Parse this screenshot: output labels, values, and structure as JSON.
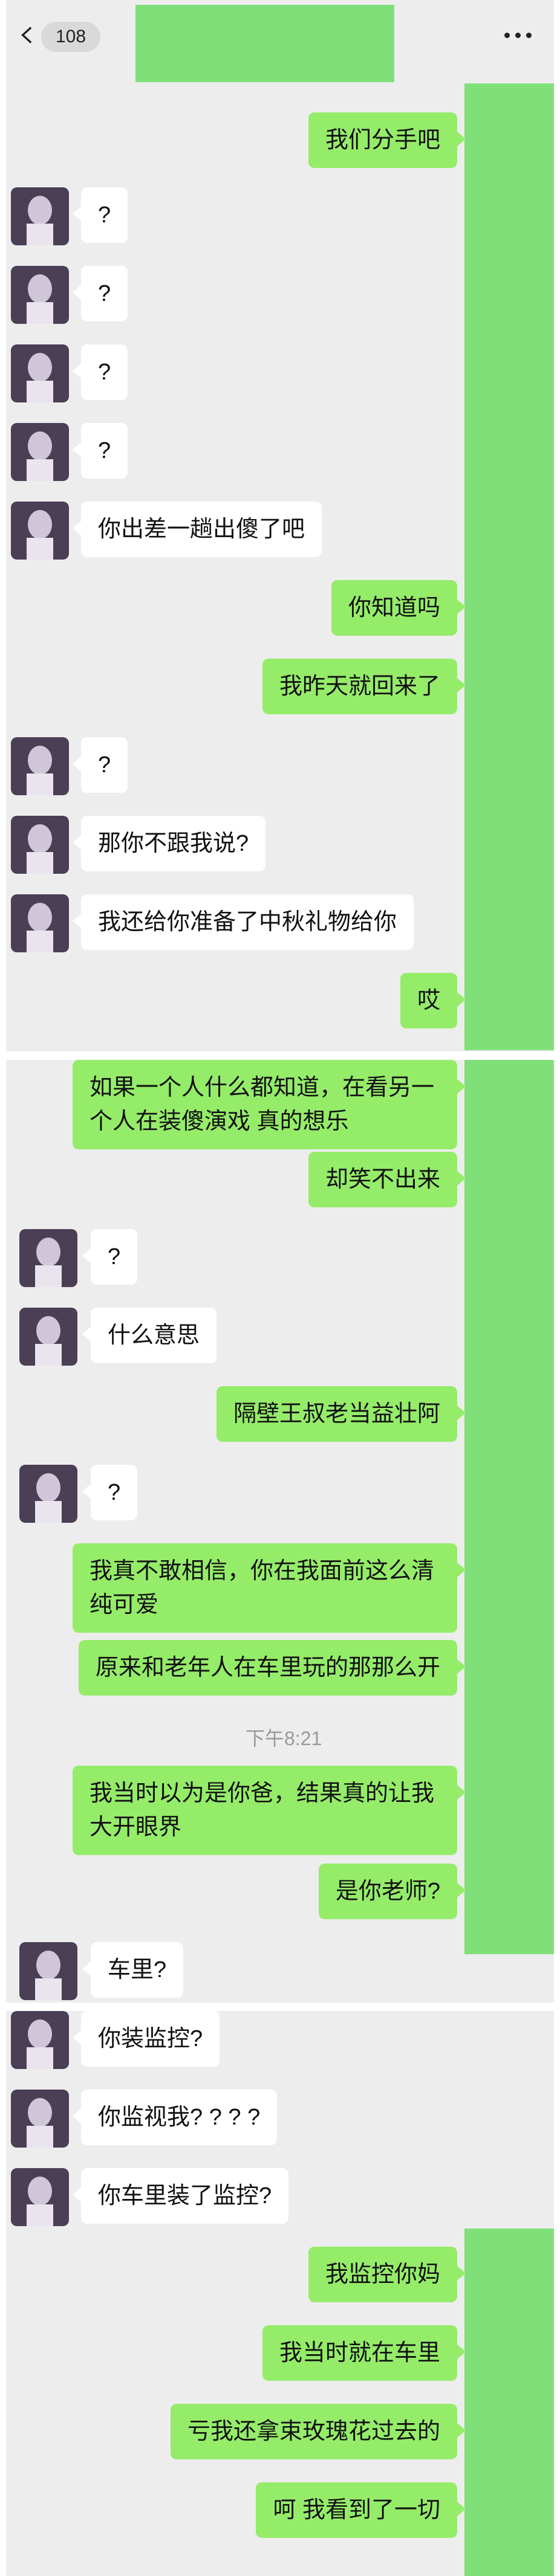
{
  "header": {
    "unread_count": "108"
  },
  "colors": {
    "panel_bg": "#ededed",
    "bubble_out": "#95ec69",
    "bubble_in": "#ffffff",
    "redaction": "#7fe07a"
  },
  "panel1": {
    "messages": [
      {
        "side": "out",
        "text": "我们分手吧"
      },
      {
        "side": "in",
        "text": "?"
      },
      {
        "side": "in",
        "text": "?"
      },
      {
        "side": "in",
        "text": "?"
      },
      {
        "side": "in",
        "text": "?"
      },
      {
        "side": "in",
        "text": "你出差一趟出傻了吧"
      },
      {
        "side": "out",
        "text": "你知道吗"
      },
      {
        "side": "out",
        "text": "我昨天就回来了"
      },
      {
        "side": "in",
        "text": "?"
      },
      {
        "side": "in",
        "text": "那你不跟我说?"
      },
      {
        "side": "in",
        "text": "我还给你准备了中秋礼物给你"
      },
      {
        "side": "out",
        "text": "哎"
      }
    ]
  },
  "panel2": {
    "messages": [
      {
        "side": "out",
        "text": "如果一个人什么都知道，在看另一个人在装傻演戏 真的想乐"
      },
      {
        "side": "out",
        "text": "却笑不出来"
      },
      {
        "side": "in",
        "text": "?"
      },
      {
        "side": "in",
        "text": "什么意思"
      },
      {
        "side": "out",
        "text": "隔壁王叔老当益壮阿"
      },
      {
        "side": "in",
        "text": "?"
      },
      {
        "side": "out",
        "text": "我真不敢相信，你在我面前这么清纯可爱"
      },
      {
        "side": "out",
        "text": "原来和老年人在车里玩的那那么开"
      },
      {
        "side": "time",
        "text": "下午8:21"
      },
      {
        "side": "out",
        "text": "我当时以为是你爸，结果真的让我大开眼界"
      },
      {
        "side": "out",
        "text": "是你老师?"
      },
      {
        "side": "in",
        "text": "车里?"
      }
    ]
  },
  "panel3": {
    "messages": [
      {
        "side": "in",
        "text": "你装监控?"
      },
      {
        "side": "in",
        "text": "你监视我? ? ? ?"
      },
      {
        "side": "in",
        "text": "你车里装了监控?"
      },
      {
        "side": "out",
        "text": "我监控你妈"
      },
      {
        "side": "out",
        "text": "我当时就在车里"
      },
      {
        "side": "out",
        "text": "亏我还拿束玫瑰花过去的"
      },
      {
        "side": "out",
        "text": "呵 我看到了一切"
      }
    ]
  }
}
